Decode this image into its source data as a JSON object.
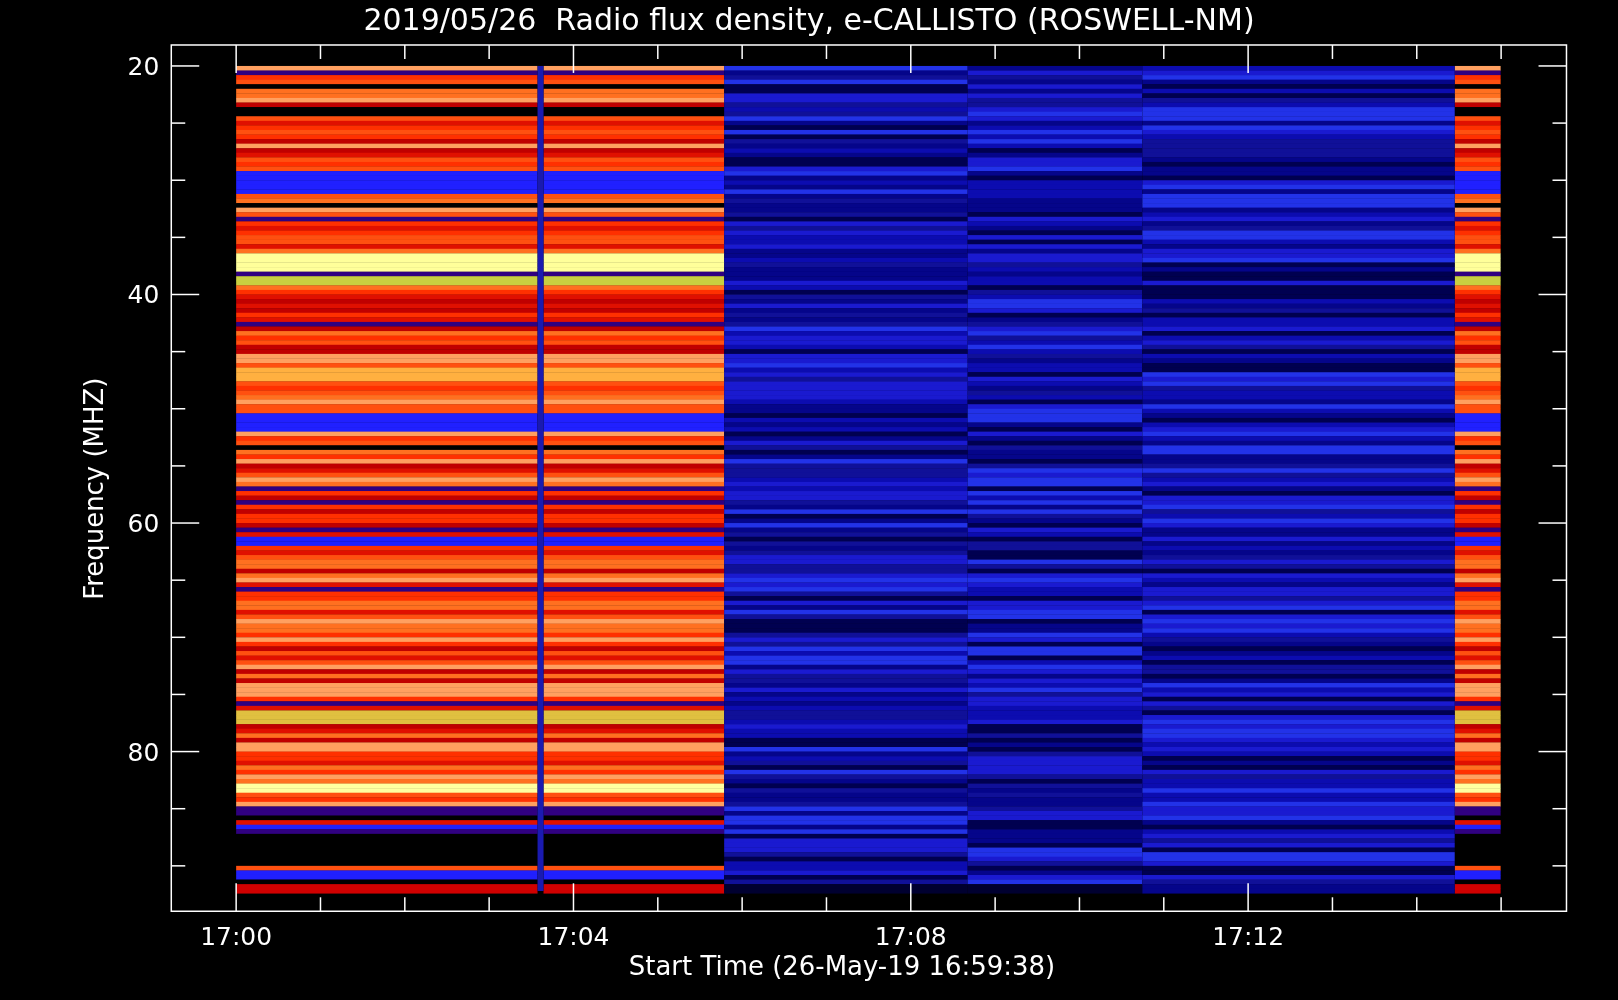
{
  "plot": {
    "title": "2019/05/26  Radio flux density, e-CALLISTO (ROSWELL-NM)",
    "ylabel": "Frequency (MHZ)",
    "xlabel": "Start Time (26-May-19 16:59:38)",
    "yticks": [
      "20",
      "40",
      "60",
      "80"
    ],
    "xticks": [
      "17:00",
      "17:04",
      "17:08",
      "17:12"
    ]
  }
}
